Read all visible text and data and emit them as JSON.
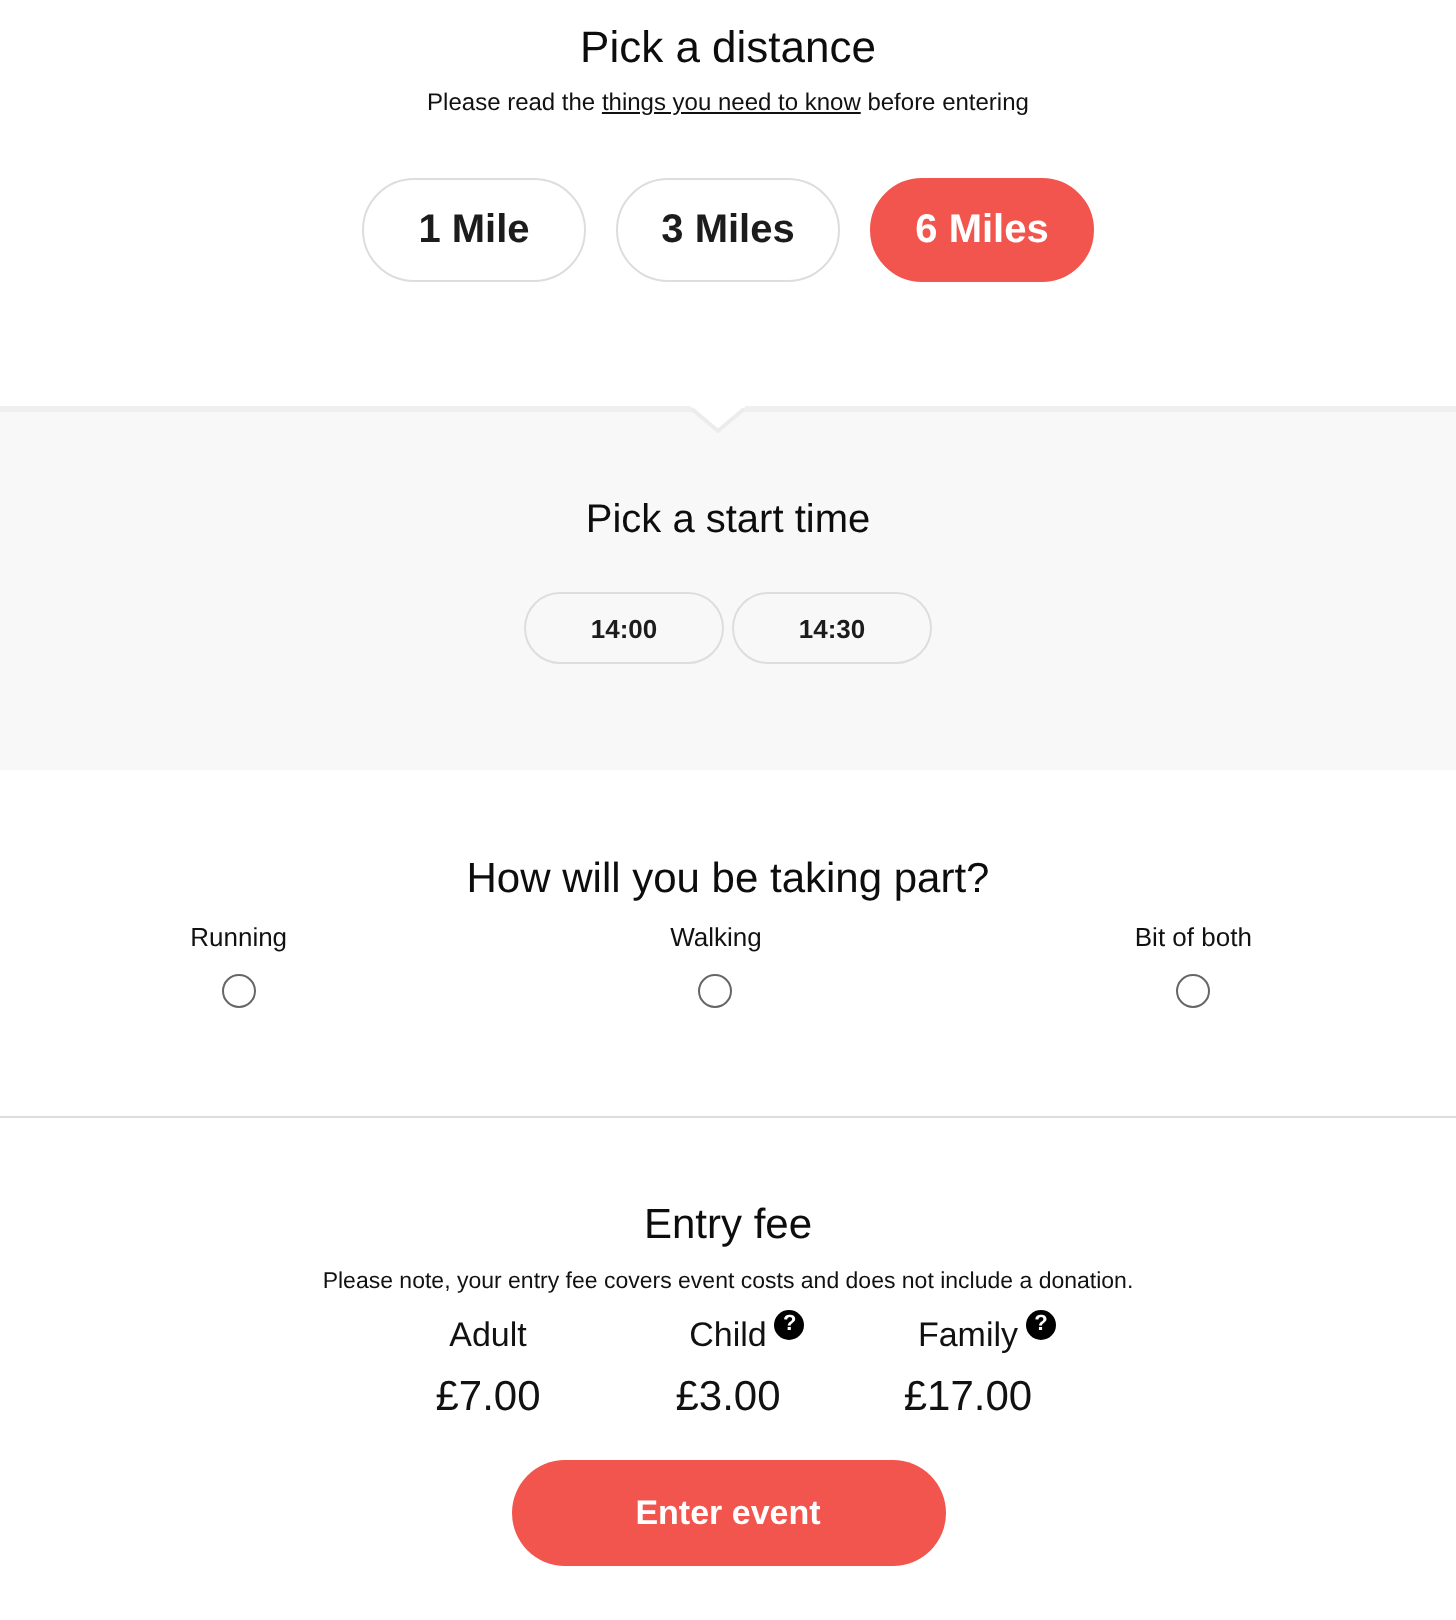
{
  "distance": {
    "title": "Pick a distance",
    "note": {
      "before": "Please read the ",
      "link": "things you need to know",
      "after": " before entering"
    },
    "options": [
      {
        "label": "1 Mile",
        "selected": false
      },
      {
        "label": "3 Miles",
        "selected": false
      },
      {
        "label": "6 Miles",
        "selected": true
      }
    ]
  },
  "start_time": {
    "title": "Pick a start time",
    "options": [
      {
        "label": "14:00",
        "selected": false
      },
      {
        "label": "14:30",
        "selected": false
      }
    ]
  },
  "participation": {
    "title": "How will you be taking part?",
    "options": [
      {
        "label": "Running",
        "selected": false
      },
      {
        "label": "Walking",
        "selected": false
      },
      {
        "label": "Bit of both",
        "selected": false
      }
    ]
  },
  "entry_fee": {
    "title": "Entry fee",
    "note": "Please note, your entry fee covers event costs and does not include a donation.",
    "fees": [
      {
        "label": "Adult",
        "price": "£7.00"
      },
      {
        "label": "Child",
        "help": "?",
        "price": "£3.00"
      },
      {
        "label": "Family",
        "help": "?",
        "price": "£17.00"
      }
    ]
  },
  "submit_button": {
    "label": "Enter event"
  }
}
